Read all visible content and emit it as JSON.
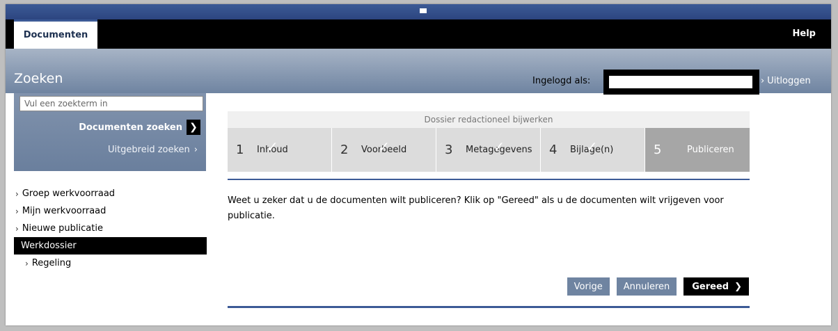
{
  "nav": {
    "tab_documents": "Documenten",
    "help": "Help"
  },
  "header": {
    "title": "Zoeken",
    "logged_in_label": "Ingelogd als:",
    "logged_in_user": "",
    "logout": "Uitloggen"
  },
  "search": {
    "placeholder": "Vul een zoekterm in",
    "value": "",
    "documents_search": "Documenten zoeken",
    "advanced_search": "Uitgebreid zoeken"
  },
  "sidebar": {
    "items": [
      {
        "label": "Groep werkvoorraad"
      },
      {
        "label": "Mijn werkvoorraad"
      },
      {
        "label": "Nieuwe publicatie"
      },
      {
        "label": "Werkdossier"
      },
      {
        "label": "Regeling"
      }
    ]
  },
  "wizard": {
    "title": "Dossier redactioneel bijwerken",
    "steps": [
      {
        "number": "1",
        "label": "Inhoud",
        "completed": true
      },
      {
        "number": "2",
        "label": "Voorbeeld",
        "completed": true
      },
      {
        "number": "3",
        "label": "Metagegevens",
        "completed": true
      },
      {
        "number": "4",
        "label": "Bijlage(n)",
        "completed": true
      },
      {
        "number": "5",
        "label": "Publiceren",
        "active": true
      }
    ]
  },
  "message": "Weet u zeker dat u de documenten wilt publiceren? Klik op \"Gereed\" als u de documenten wilt vrijgeven voor publicatie.",
  "buttons": {
    "previous": "Vorige",
    "cancel": "Annuleren",
    "done": "Gereed"
  },
  "icons": {
    "chevron_right": "›",
    "arrow_right": "❯",
    "checkmark": "✓"
  },
  "colors": {
    "accent_blue": "#3c5a96",
    "header_grey_blue": "#6f84a1",
    "navbar": "#000000",
    "active_step": "#a6a6a6",
    "inactive_step": "#dcdcdc"
  }
}
